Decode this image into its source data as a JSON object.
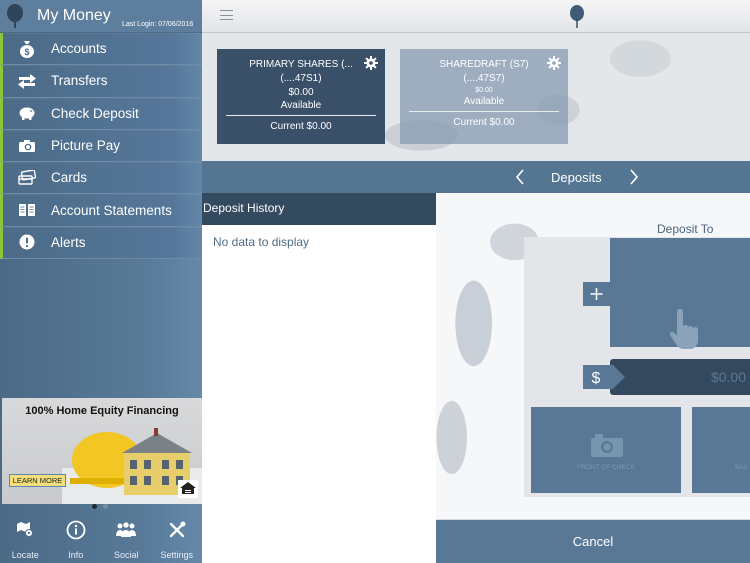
{
  "sidebar": {
    "title": "My Money",
    "last_login": "Last Login: 07/06/2016",
    "nav_items": [
      {
        "label": "Accounts",
        "icon": "money-bag-icon"
      },
      {
        "label": "Transfers",
        "icon": "transfer-arrows-icon"
      },
      {
        "label": "Check Deposit",
        "icon": "piggy-bank-icon"
      },
      {
        "label": "Picture Pay",
        "icon": "camera-icon"
      },
      {
        "label": "Cards",
        "icon": "cards-icon"
      },
      {
        "label": "Account Statements",
        "icon": "book-icon"
      },
      {
        "label": "Alerts",
        "icon": "alert-icon"
      }
    ],
    "ad": {
      "title": "100% Home Equity Financing",
      "button_label": "LEARN MORE",
      "carousel_page": 1,
      "carousel_total": 2
    },
    "bottom_items": [
      {
        "label": "Locate",
        "icon": "map-pin-icon"
      },
      {
        "label": "Info",
        "icon": "info-icon"
      },
      {
        "label": "Social",
        "icon": "people-icon"
      },
      {
        "label": "Settings",
        "icon": "tools-icon"
      }
    ]
  },
  "accounts": [
    {
      "name": "PRIMARY SHARES (...",
      "number": "(....47S1)",
      "amount": "$0.00",
      "available_label": "Available",
      "current": "Current $0.00"
    },
    {
      "name": "SHAREDRAFT (S7)",
      "number": "(....47S7)",
      "amount": "$0.00",
      "available_label": "Available",
      "current": "Current $0.00"
    }
  ],
  "deposits_bar": {
    "title": "Deposits"
  },
  "history": {
    "header": "Deposit History",
    "empty_text": "No data to display"
  },
  "deposit_form": {
    "deposit_to_label": "Deposit To",
    "amount_placeholder": "$0.00",
    "front_label": "FRONT OF CHECK",
    "back_label": "BAC"
  },
  "cancel_label": "Cancel",
  "colors": {
    "accent_green": "#8cc63f",
    "primary_blue": "#587895",
    "dark_blue": "#344a5f"
  }
}
